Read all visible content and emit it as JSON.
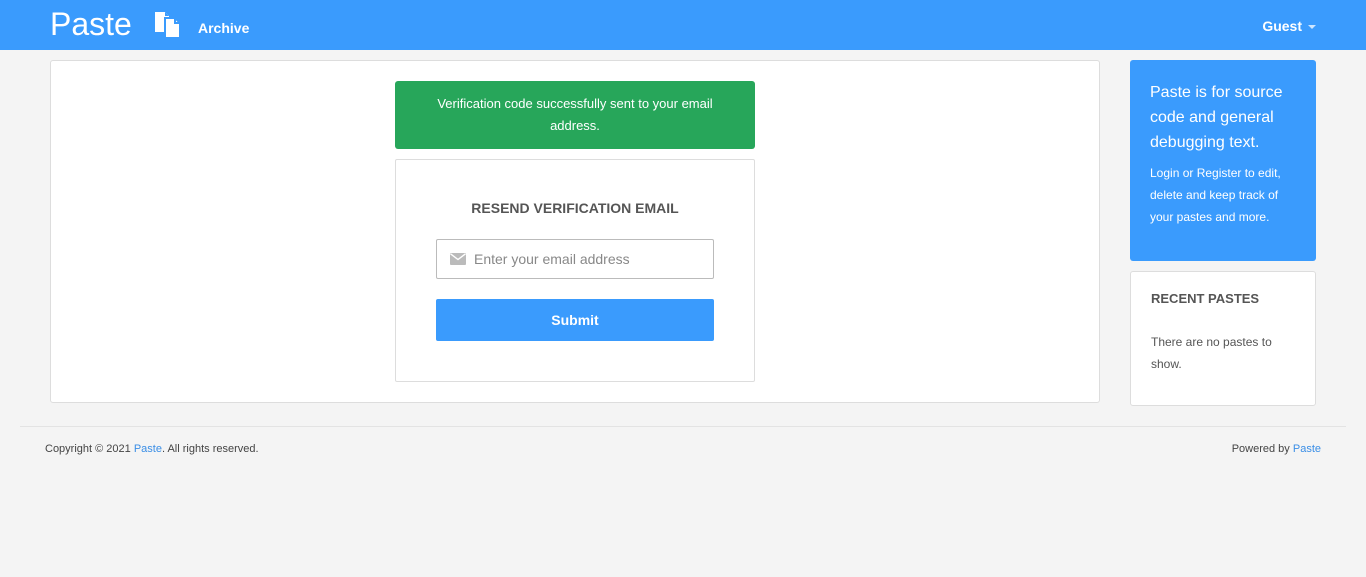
{
  "navbar": {
    "brand": "Paste",
    "brand_icon": "copy-document-icon",
    "archive_label": "Archive",
    "user_label": "Guest",
    "accent_color": "#3a9bfd"
  },
  "alert": {
    "message": "Verification code successfully sent to your email address.",
    "color": "#27a65a"
  },
  "form": {
    "title": "RESEND VERIFICATION EMAIL",
    "email_icon": "envelope-icon",
    "email_placeholder": "Enter your email address",
    "email_value": "",
    "submit_label": "Submit"
  },
  "sidebar": {
    "info_heading": "Paste is for source code and general debugging text.",
    "info_text": "Login or Register to edit, delete and keep track of your pastes and more.",
    "recent_title": "RECENT PASTES",
    "recent_empty": "There are no pastes to show."
  },
  "footer": {
    "copyright_prefix": "Copyright © 2021 ",
    "copyright_link": "Paste",
    "copyright_suffix": ". All rights reserved.",
    "powered_prefix": "Powered by ",
    "powered_link": "Paste"
  }
}
